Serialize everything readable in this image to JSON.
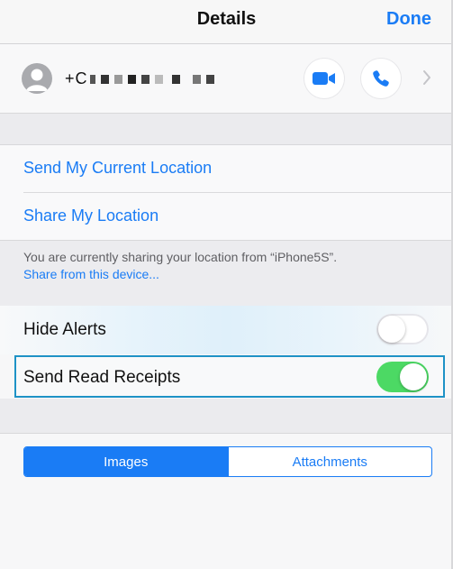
{
  "nav": {
    "title": "Details",
    "done_label": "Done"
  },
  "contact": {
    "phone_number_prefix": "+C",
    "redacted_number": true,
    "video_call_icon": "video-camera-icon",
    "audio_call_icon": "phone-icon",
    "disclosure_icon": "chevron-right-icon"
  },
  "location": {
    "send_current_label": "Send My Current Location",
    "share_label": "Share My Location",
    "info_text": "You are currently sharing your location from “iPhone5S”.",
    "share_from_device_link": "Share from this device..."
  },
  "settings": {
    "hide_alerts_label": "Hide Alerts",
    "hide_alerts_on": false,
    "read_receipts_label": "Send Read Receipts",
    "read_receipts_on": true
  },
  "segmented": {
    "options": [
      "Images",
      "Attachments"
    ],
    "selected": "Images"
  },
  "colors": {
    "accent": "#1a7cf5",
    "switch_on": "#4cd964",
    "focus_outline": "#1e92c6"
  }
}
